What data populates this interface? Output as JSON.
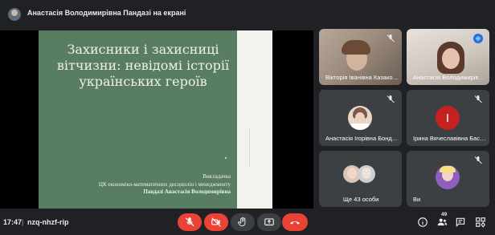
{
  "header": {
    "presenting_text": "Анастасія Володимирівна Пандазі на екрані"
  },
  "slide": {
    "title_lines": [
      "Захисники і захисниці",
      "вітчизни: невідомі історії",
      "українських героїв"
    ],
    "footer_line1": "Викладачка",
    "footer_line2": "ЦК економіко-математичних дисциплін і менеджменту",
    "footer_line3": "Пандазі Анастасія Володимирівна"
  },
  "participants": {
    "tile1_name": "Вікторія Іванівна Казако…",
    "tile2_name": "Анастасія Володимирів…",
    "tile3_name": "Анастасія Ігорівна Бонд…",
    "tile4_name": "Ірина Вячеславівна Бас…",
    "tile4_initial": "І",
    "tile5_name": "Ще 43 особи",
    "tile6_name": "Ви"
  },
  "bottom": {
    "time": "17:47",
    "separator": "|",
    "meeting_code": "nzq-nhzf-rip",
    "people_count": "49"
  },
  "colors": {
    "slide_bg": "#587d62",
    "end_call": "#ea4335",
    "mic_off": "#ea4335"
  },
  "icons": [
    "mic-off-icon",
    "camera-off-icon",
    "raise-hand-icon",
    "present-icon",
    "more-icon",
    "end-call-icon",
    "info-icon",
    "people-icon",
    "chat-icon",
    "activities-icon",
    "speaking-icon"
  ]
}
